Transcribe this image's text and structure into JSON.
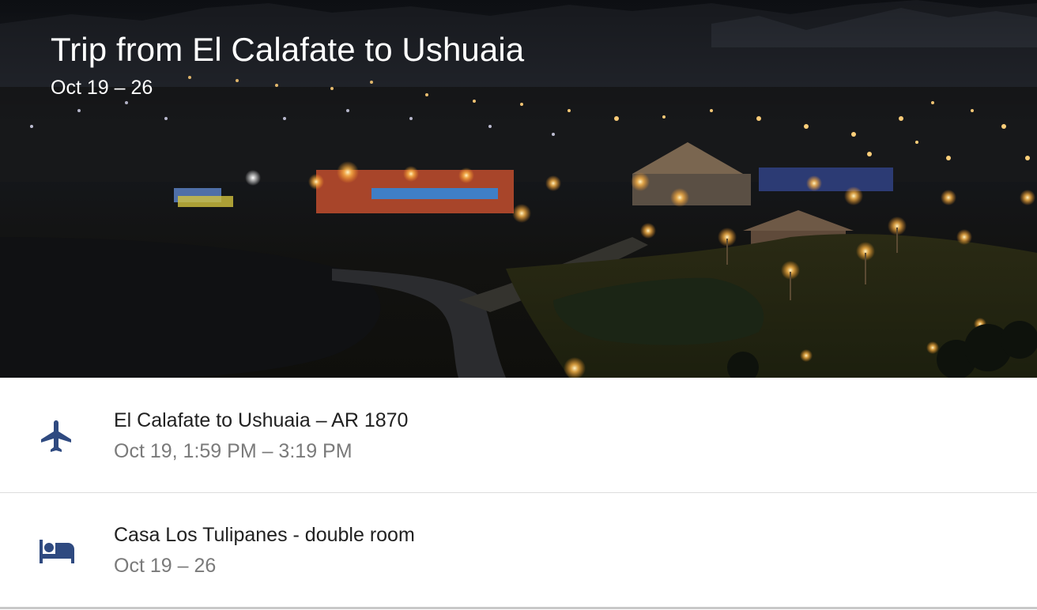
{
  "trip": {
    "title": "Trip from El Calafate to Ushuaia",
    "dates": "Oct 19 – 26"
  },
  "items": [
    {
      "icon": "airplane-icon",
      "title": "El Calafate to Ushuaia – AR 1870",
      "subtitle": "Oct 19, 1:59 PM – 3:19 PM"
    },
    {
      "icon": "hotel-bed-icon",
      "title": "Casa Los Tulipanes - double room",
      "subtitle": "Oct 19 – 26"
    }
  ],
  "colors": {
    "icon": "#2f4a80",
    "primary_text": "#212121",
    "secondary_text": "#7a7a7a",
    "divider": "#dcdcdc"
  }
}
